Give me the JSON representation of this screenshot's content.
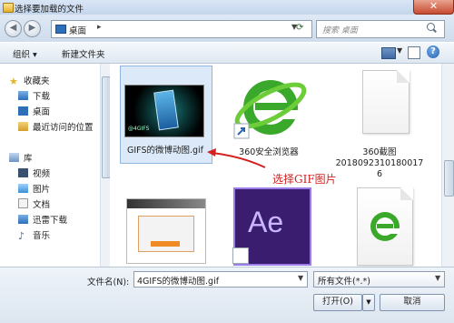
{
  "window": {
    "title": "选择要加载的文件",
    "close_glyph": "✕"
  },
  "address_bar": {
    "location": "桌面",
    "separator": "▸",
    "search_placeholder": "搜索 桌面"
  },
  "toolbar": {
    "organize_label": "组织 ▾",
    "new_folder_label": "新建文件夹"
  },
  "nav_pane": {
    "favorites_label": "收藏夹",
    "favorites": [
      "下载",
      "桌面",
      "最近访问的位置"
    ],
    "libraries_label": "库",
    "libraries": [
      "视频",
      "图片",
      "文档",
      "迅雷下载",
      "音乐"
    ]
  },
  "files": [
    {
      "name": "GIFS的微博动图.gif",
      "icon": "gif-thumbnail",
      "selected": true
    },
    {
      "name": "360安全浏览器",
      "icon": "ie-shortcut-icon"
    },
    {
      "name": "360截图\n2018092310180017\n6",
      "icon": "document-icon"
    },
    {
      "name": "",
      "icon": "screenshot-thumbnail"
    },
    {
      "name": "",
      "icon": "after-effects-icon"
    },
    {
      "name": "",
      "icon": "ie-document-icon"
    }
  ],
  "annotation": {
    "text": "选择GIF图片",
    "color": "#d6201f"
  },
  "bottom": {
    "filename_label": "文件名(N):",
    "filename_value": "4GIFS的微博动图.gif",
    "filetype_value": "所有文件(*.*)",
    "open_label": "打开(O)",
    "cancel_label": "取消"
  },
  "colors": {
    "selection": "#dbe9f8",
    "ie_green": "#3aa82a",
    "ae_purple": "#3a1d6e"
  }
}
